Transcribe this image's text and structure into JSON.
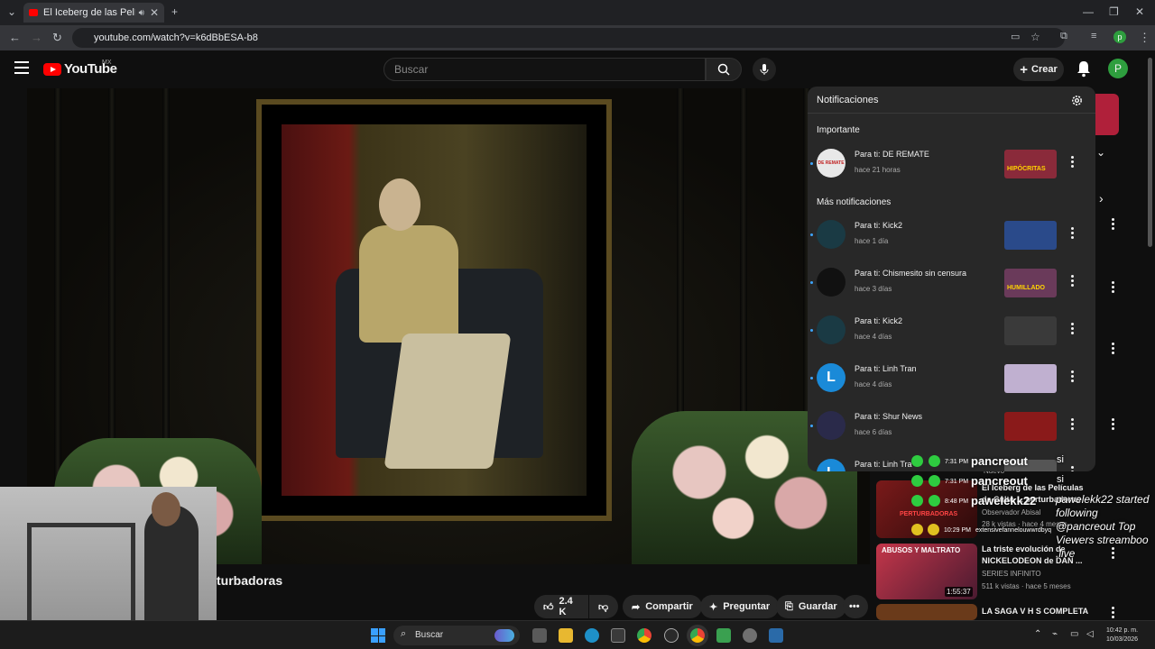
{
  "browser": {
    "tab_title": "El Iceberg de las Películas M",
    "url": "youtube.com/watch?v=k6dBbESA-b8"
  },
  "youtube": {
    "logo": "YouTube",
    "region": "MX",
    "search_placeholder": "Buscar",
    "create_label": "Crear",
    "avatar_letter": "P"
  },
  "video": {
    "title_fragment": "turbadoras",
    "like_count": "2.4 K",
    "share_label": "Compartir",
    "ask_label": "Preguntar",
    "save_label": "Guardar"
  },
  "notifications": {
    "title": "Notificaciones",
    "section_important": "Importante",
    "section_more": "Más notificaciones",
    "items": [
      {
        "text": "Para ti: DE REMATE",
        "time": "hace 21 horas",
        "avatar": "DE REMATE",
        "thumb_text": "HIPÓCRITAS",
        "avatar_color": "#e8e8e8",
        "thumb_color": "#8a2a3a"
      },
      {
        "text": "Para ti: Kick2",
        "time": "hace 1 día",
        "avatar": "",
        "thumb_text": "",
        "avatar_color": "#1a3a44",
        "thumb_color": "#2a4a8a"
      },
      {
        "text": "Para ti: Chismesito sin censura",
        "time": "hace 3 días",
        "avatar": "",
        "thumb_text": "HUMILLADO",
        "avatar_color": "#111111",
        "thumb_color": "#6a3a5a"
      },
      {
        "text": "Para ti: Kick2",
        "time": "hace 4 días",
        "avatar": "",
        "thumb_text": "",
        "avatar_color": "#1a3a44",
        "thumb_color": "#3a3a3a"
      },
      {
        "text": "Para ti: Linh Tran",
        "time": "hace 4 días",
        "avatar": "L",
        "thumb_text": "",
        "avatar_color": "#1a8ad8",
        "thumb_color": "#c0b0d0"
      },
      {
        "text": "Para ti: Shur News",
        "time": "hace 6 días",
        "avatar": "",
        "thumb_text": "",
        "avatar_color": "#2a2a4a",
        "thumb_color": "#8a1a1a"
      },
      {
        "text": "Para ti: Linh Tra",
        "time": "",
        "avatar": "L",
        "thumb_text": "",
        "avatar_color": "#1a8ad8",
        "thumb_color": "#555555"
      }
    ]
  },
  "recommendations": [
    {
      "title": "El Iceberg de las Películas de Culto ... perturbadoras",
      "channel": "Observador Abisal",
      "meta": "28 k vistas · hace 4 meses",
      "duration": "",
      "badge": "Nuevo",
      "thumb_text": "PERTURBADORAS"
    },
    {
      "title": "La triste evolución de NICKELODEON de DAN ...",
      "channel": "SERIES INFINITO",
      "meta": "511 k vistas · hace 5 meses",
      "duration": "1:55:37",
      "badge": "",
      "thumb_text": "ABUSOS Y MALTRATO"
    },
    {
      "title": "LA SAGA V H S COMPLETA",
      "channel": "",
      "meta": "",
      "duration": "",
      "badge": "",
      "thumb_text": ""
    }
  ],
  "chat": [
    {
      "time": "7:31 PM",
      "user": "pancreout",
      "msg": "si"
    },
    {
      "time": "7:31 PM",
      "user": "pancreout",
      "msg": "si"
    },
    {
      "time": "8:48 PM",
      "user": "pawelekk22",
      "msg": ""
    },
    {
      "time": "10:29 PM",
      "user": "extensivefannelouwwrdbyq",
      "msg": ""
    }
  ],
  "follow_event": "pawelekk22 started following @pancreout Top Viewers streamboo .live",
  "taskbar": {
    "search": "Buscar",
    "time": "10:42 p. m.",
    "date": "10/03/2026"
  }
}
